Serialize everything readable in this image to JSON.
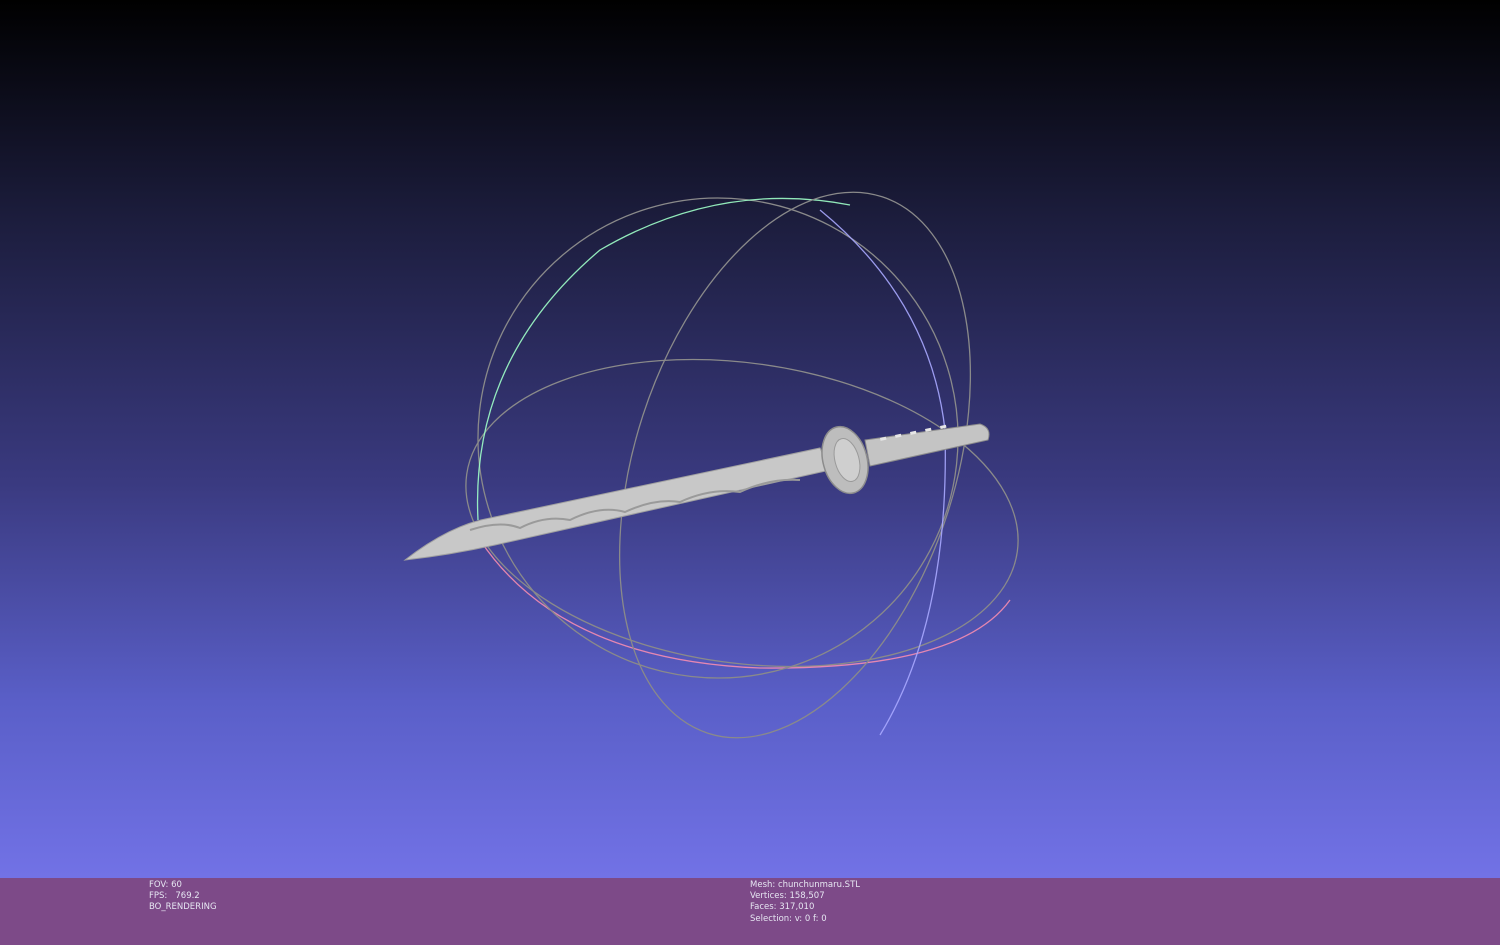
{
  "viewer": {
    "colors": {
      "bg_top": "#000000",
      "bg_bottom": "#7272e6",
      "status_bar": "#7d4a88",
      "mesh": "#c8c8c8",
      "trackball_x": "#ff8fb0",
      "trackball_y": "#9fffc8",
      "trackball_z": "#a8a8ff"
    },
    "render_info": {
      "fov": "FOV: 60",
      "fps": "FPS:   769.2",
      "mode": "BO_RENDERING"
    },
    "mesh_info": {
      "mesh": "Mesh: chunchunmaru.STL",
      "vertices": "Vertices: 158,507",
      "faces": "Faces: 317,010",
      "selection": "Selection: v: 0 f: 0"
    }
  }
}
